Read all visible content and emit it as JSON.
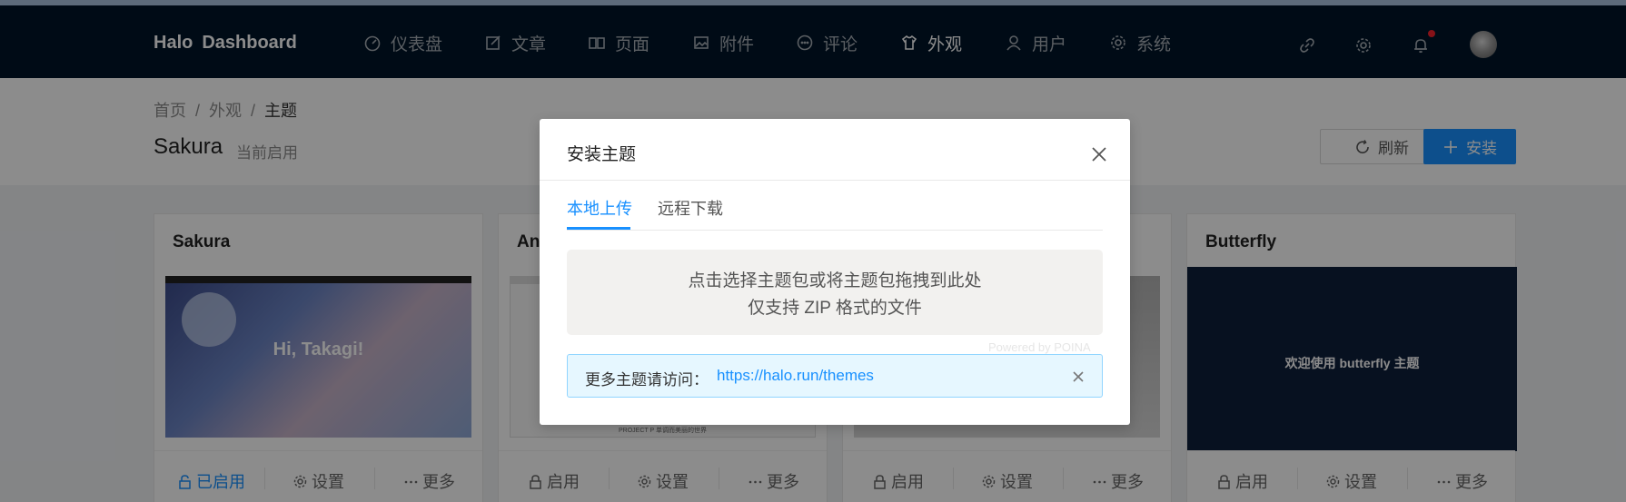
{
  "brand": {
    "part1": "Halo",
    "part2": "Dashboard"
  },
  "nav": {
    "items": [
      {
        "label": "仪表盘",
        "icon": "dashboard-icon"
      },
      {
        "label": "文章",
        "icon": "edit-icon"
      },
      {
        "label": "页面",
        "icon": "book-icon"
      },
      {
        "label": "附件",
        "icon": "picture-icon"
      },
      {
        "label": "评论",
        "icon": "comment-icon"
      },
      {
        "label": "外观",
        "icon": "skin-icon",
        "active": true
      },
      {
        "label": "用户",
        "icon": "user-icon"
      },
      {
        "label": "系统",
        "icon": "setting-icon"
      }
    ],
    "right_icons": [
      "link-icon",
      "gear-icon",
      "bell-icon",
      "avatar"
    ]
  },
  "breadcrumb": {
    "home": "首页",
    "appearance": "外观",
    "current": "主题"
  },
  "page": {
    "title": "Sakura",
    "subtitle": "当前启用"
  },
  "toolbar": {
    "refresh_label": "刷新",
    "install_label": "安装"
  },
  "cards": [
    {
      "title": "Sakura",
      "thumb_text": "Hi, Takagi!",
      "actions": [
        "已启用",
        "设置",
        "更多"
      ],
      "enabled": true
    },
    {
      "title": "An",
      "thumb_text": "PROJECT P 单调而美丽的世界",
      "actions": [
        "启用",
        "设置",
        "更多"
      ]
    },
    {
      "title": "",
      "actions": [
        "启用",
        "设置",
        "更多"
      ]
    },
    {
      "title": "Butterfly",
      "thumb_text": "欢迎使用 butterfly 主题",
      "actions": [
        "启用",
        "设置",
        "更多"
      ]
    }
  ],
  "modal": {
    "title": "安装主题",
    "tabs": [
      {
        "label": "本地上传",
        "active": true
      },
      {
        "label": "远程下载"
      }
    ],
    "upload": {
      "line1": "点击选择主题包或将主题包拖拽到此处",
      "line2": "仅支持 ZIP 格式的文件"
    },
    "powered": "Powered by POINA",
    "info": {
      "label": "更多主题请访问：",
      "link": "https://halo.run/themes"
    }
  },
  "colors": {
    "primary": "#1890ff",
    "nav_bg": "#001529",
    "notify_dot": "#f5222d"
  }
}
